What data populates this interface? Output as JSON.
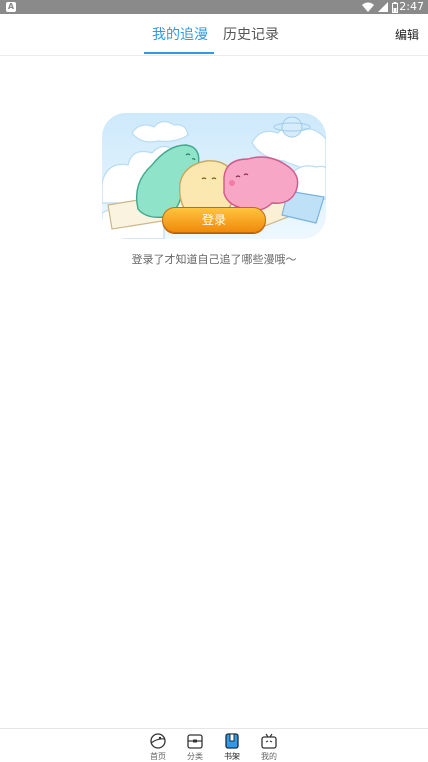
{
  "status_bar": {
    "app_icon": "A",
    "time": "2:47",
    "icons": [
      "wifi-icon",
      "signal-icon",
      "battery-icon"
    ]
  },
  "tabs": {
    "follow": "我的追漫",
    "history": "历史记录",
    "active": "follow"
  },
  "header": {
    "edit_label": "编辑"
  },
  "main": {
    "login_label": "登录",
    "empty_message": "登录了才知道自己追了哪些漫哦～"
  },
  "bottom_nav": {
    "items": [
      {
        "label": "首页",
        "icon": "home-planet-icon"
      },
      {
        "label": "分类",
        "icon": "category-box-icon"
      },
      {
        "label": "书架",
        "icon": "bookshelf-icon",
        "active": true
      },
      {
        "label": "我的",
        "icon": "profile-tv-icon"
      }
    ]
  },
  "colors": {
    "accent": "#2f9ae8",
    "login_button": "#f5a21d",
    "status_bar": "#8a8a8a"
  }
}
